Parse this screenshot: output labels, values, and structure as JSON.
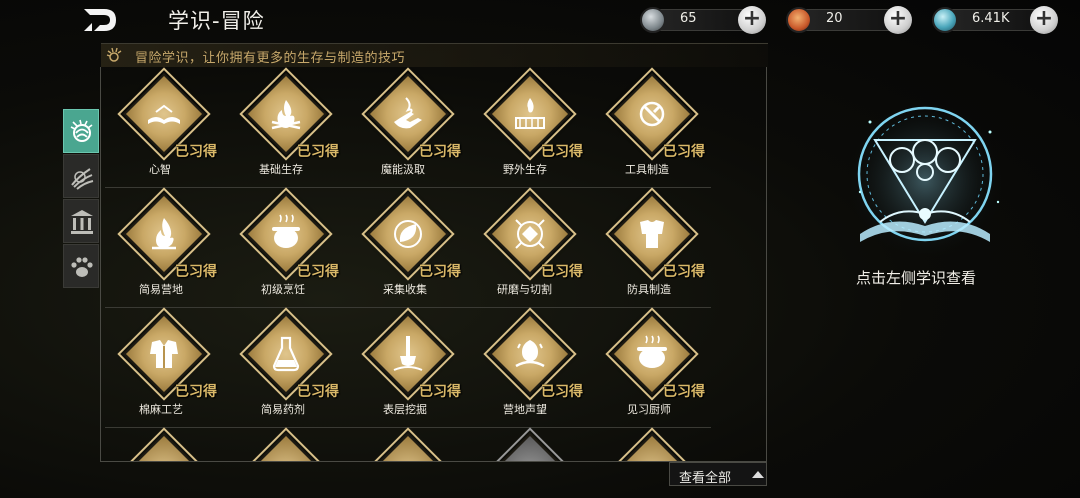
{
  "header": {
    "title": "学识-冒险"
  },
  "currencies": [
    {
      "value": "65",
      "icon": "silver-coin-icon",
      "color": "#9aa3a8"
    },
    {
      "value": "20",
      "icon": "orange-gem-icon",
      "color": "#d0742e"
    },
    {
      "value": "6.41K",
      "icon": "teal-orb-icon",
      "color": "#5fb4c6"
    }
  ],
  "subtitle": "冒险学识，让你拥有更多的生存与制造的技巧",
  "side_tabs": [
    {
      "name": "adventure-tab",
      "icon": "crest-icon",
      "active": true
    },
    {
      "name": "combat-tab",
      "icon": "claw-icon",
      "active": false
    },
    {
      "name": "building-tab",
      "icon": "pillar-icon",
      "active": false
    },
    {
      "name": "pet-tab",
      "icon": "paw-icon",
      "active": false
    }
  ],
  "learned_label": "已习得",
  "skills": [
    {
      "name": "心智",
      "icon": "book-icon"
    },
    {
      "name": "基础生存",
      "icon": "campfire-icon"
    },
    {
      "name": "魔能汲取",
      "icon": "hand-flame-icon"
    },
    {
      "name": "野外生存",
      "icon": "camp-icon"
    },
    {
      "name": "工具制造",
      "icon": "tools-icon"
    },
    {
      "name": "简易营地",
      "icon": "bonfire-icon"
    },
    {
      "name": "初级烹饪",
      "icon": "pot-icon"
    },
    {
      "name": "采集收集",
      "icon": "leaf-icon"
    },
    {
      "name": "研磨与切割",
      "icon": "gem-cut-icon"
    },
    {
      "name": "防具制造",
      "icon": "armor-icon"
    },
    {
      "name": "棉麻工艺",
      "icon": "robe-icon"
    },
    {
      "name": "简易药剂",
      "icon": "flask-icon"
    },
    {
      "name": "表层挖掘",
      "icon": "shovel-icon"
    },
    {
      "name": "营地声望",
      "icon": "reputation-icon"
    },
    {
      "name": "见习厨师",
      "icon": "cauldron-icon"
    }
  ],
  "view_all": "查看全部",
  "emblem_hint": "点击左侧学识查看"
}
